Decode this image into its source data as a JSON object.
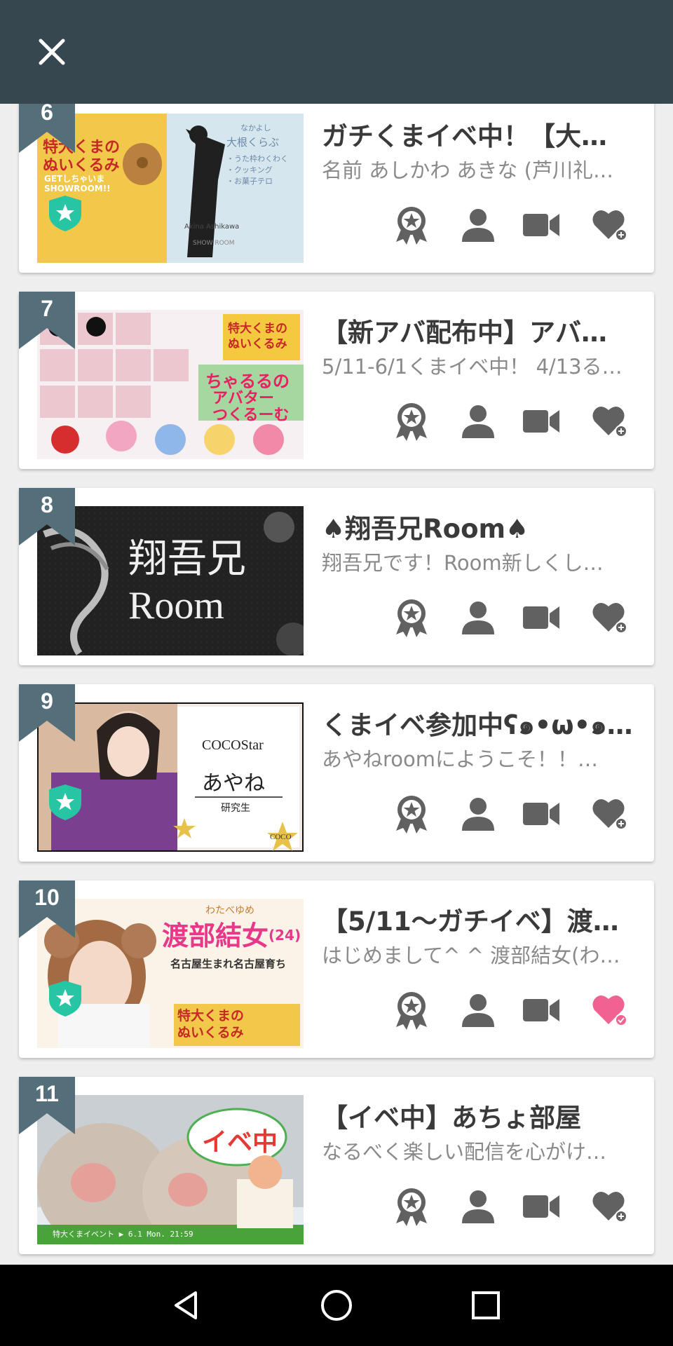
{
  "header": {
    "close_icon": "close-icon",
    "background": "#37474f"
  },
  "colors": {
    "rank_badge": "#546e7a",
    "shield": "#26c6a4",
    "icon_gray": "#616161",
    "heart_active": "#f06292",
    "title": "#3a3a3a",
    "subtitle": "#8a8a8a"
  },
  "rooms": [
    {
      "rank": "6",
      "title": "ガチくまイベ中！【大…",
      "subtitle": "名前 あしかわ あきな (芦川礼…",
      "official": true,
      "followed": false,
      "thumb": {
        "lines": [
          "特大くまの",
          "ぬいくるみ",
          "GETしちゃいま",
          "SHOWROOM!!"
        ],
        "side": [
          "なかよし",
          "大根くらぶ",
          "・うた枠わくわく",
          "・クッキング",
          "・お菓子テロ"
        ],
        "caption": "Akina Ashikawa",
        "brand": "SHOW ROOM"
      }
    },
    {
      "rank": "7",
      "title": "【新アバ配布中】アバ…",
      "subtitle": "5/11-6/1くまイベ中！ 4/13る…",
      "official": false,
      "followed": false,
      "thumb": {
        "lines": [
          "特大くまの",
          "ぬいくるみ"
        ],
        "side": [
          "ちゃるるの",
          "アバター",
          "つくるーむ"
        ]
      }
    },
    {
      "rank": "8",
      "title": "♠翔吾兄Room♠",
      "subtitle": "翔吾兄です！Room新しくし…",
      "official": false,
      "followed": false,
      "thumb": {
        "lines": [
          "翔吾兄",
          "Room"
        ]
      }
    },
    {
      "rank": "9",
      "title": "くまイベ参加中ʕ๑•ω•๑…",
      "subtitle": "あやねroomにようこそ！！…",
      "official": true,
      "followed": false,
      "thumb": {
        "lines": [
          "COCOStar",
          "あやね",
          "研究生"
        ],
        "corner": "COCO"
      }
    },
    {
      "rank": "10",
      "title": "【5/11〜ガチイベ】渡…",
      "subtitle": "はじめまして^ ^ 渡部結女(わ…",
      "official": true,
      "followed": true,
      "thumb": {
        "lines": [
          "わたべゆめ",
          "渡部結女",
          "(24)",
          "名古屋生まれ名古屋育ち",
          "特大くまの",
          "ぬいくるみ"
        ]
      }
    },
    {
      "rank": "11",
      "title": "【イベ中】あちょ部屋",
      "subtitle": "なるべく楽しい配信を心がけ…",
      "official": false,
      "followed": false,
      "thumb": {
        "lines": [
          "イベ中"
        ],
        "caption": "特大くまイベント ▶ 6.1 Mon. 21:59"
      }
    }
  ],
  "actions": {
    "medal_icon": "medal-icon",
    "person_icon": "person-icon",
    "video_icon": "video-camera-icon",
    "heart_icon": "heart-add-icon"
  },
  "navbar": {
    "back": "back-triangle-icon",
    "home": "home-circle-icon",
    "recents": "recents-square-icon"
  }
}
